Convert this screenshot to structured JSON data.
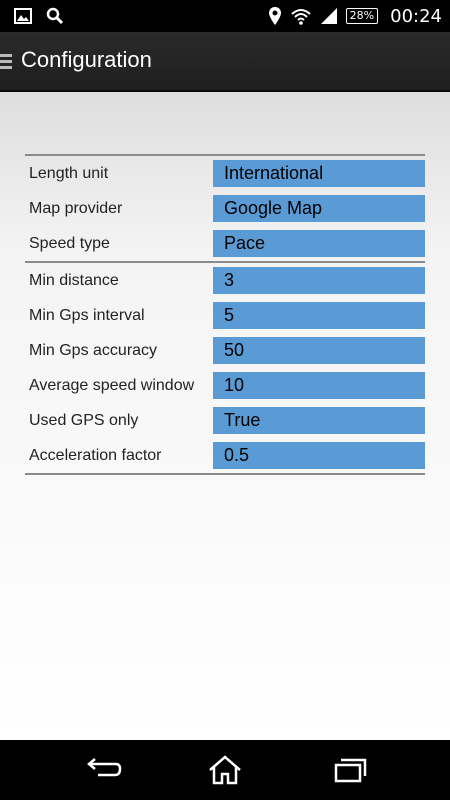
{
  "status_bar": {
    "battery": "28%",
    "time": "00:24",
    "icons": [
      "image-icon",
      "search-icon",
      "location-icon",
      "wifi-icon",
      "signal-icon",
      "battery-icon"
    ]
  },
  "action_bar": {
    "title": "Configuration",
    "menu_icon": "menu-icon"
  },
  "settings": {
    "group1": [
      {
        "label": "Length unit",
        "value": "International"
      },
      {
        "label": "Map provider",
        "value": "Google Map"
      },
      {
        "label": "Speed type",
        "value": "Pace"
      }
    ],
    "group2": [
      {
        "label": "Min distance",
        "value": "3"
      },
      {
        "label": "Min Gps interval",
        "value": "5"
      },
      {
        "label": "Min Gps accuracy",
        "value": "50"
      },
      {
        "label": "Average speed window",
        "value": "10"
      },
      {
        "label": "Used GPS only",
        "value": "True"
      },
      {
        "label": "Acceleration factor",
        "value": "0.5"
      }
    ]
  },
  "nav_bar": {
    "icons": [
      "back-icon",
      "home-icon",
      "recent-apps-icon"
    ]
  },
  "colors": {
    "value_bg": "#5b9bd5",
    "actionbar_bg": "#222222"
  }
}
